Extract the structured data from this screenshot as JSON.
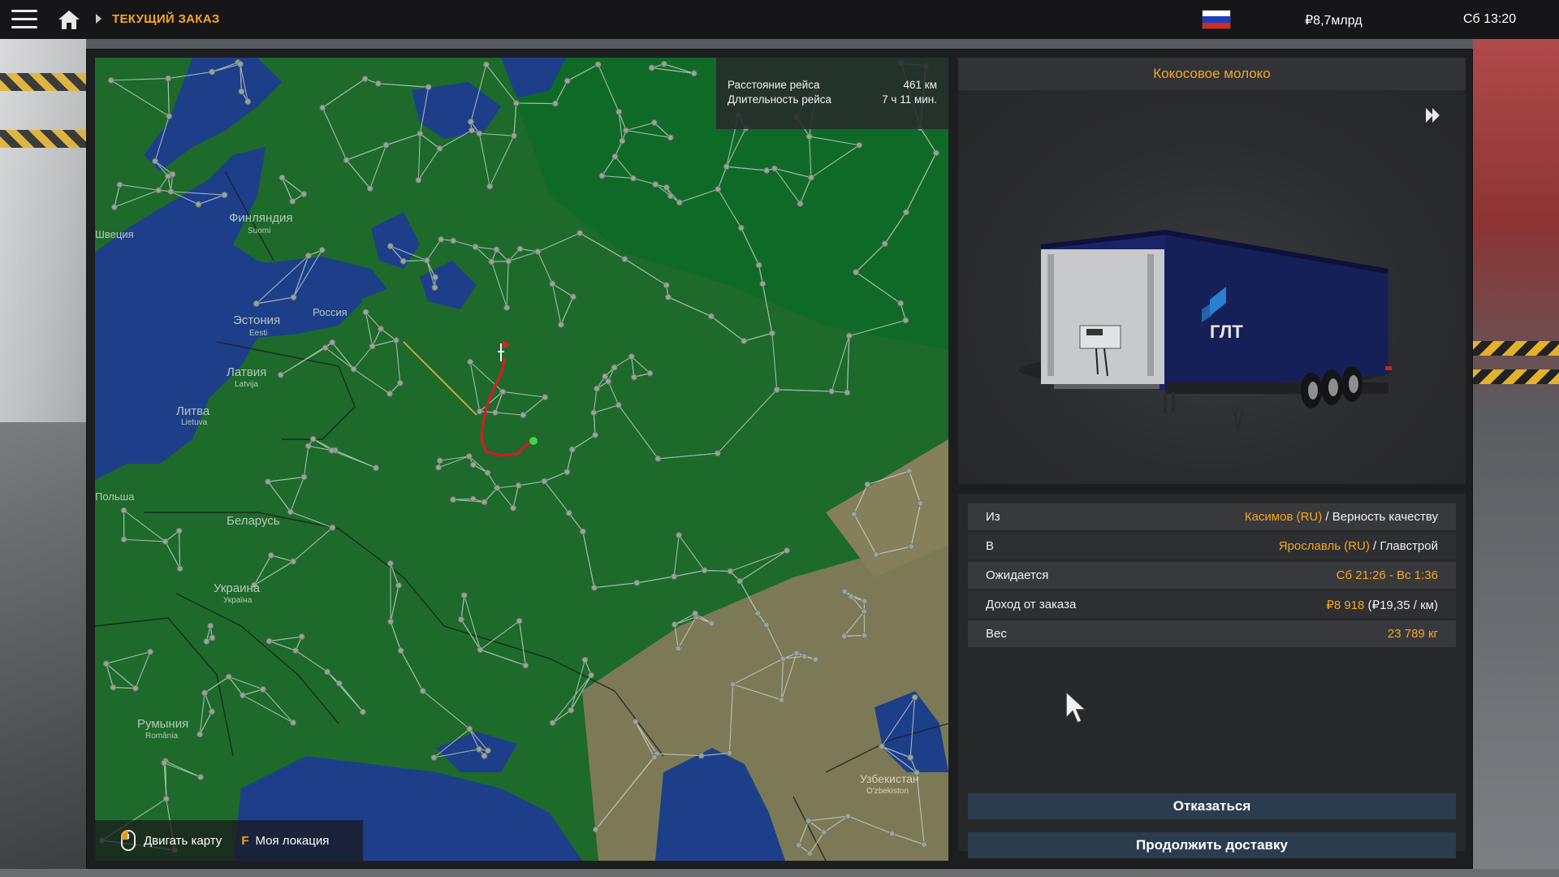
{
  "topbar": {
    "breadcrumb": "ТЕКУЩИЙ ЗАКАЗ",
    "money": "₽8,7млрд",
    "clock": "Сб 13:20",
    "flag_colors": [
      "#ffffff",
      "#1c3fbf",
      "#d52b1e"
    ]
  },
  "map": {
    "trip_distance_label": "Расстояние рейса",
    "trip_distance_value": "461 км",
    "trip_duration_label": "Длительность рейса",
    "trip_duration_value": "7 ч 11 мин.",
    "hint_move_label": "Двигать карту",
    "hint_key": "F",
    "hint_location_label": "Моя локация",
    "labels": [
      {
        "text": "Финляндия"
      },
      {
        "text": "Suomi"
      },
      {
        "text": "Эстония"
      },
      {
        "text": "Eesti"
      },
      {
        "text": "Латвия"
      },
      {
        "text": "Latvija"
      },
      {
        "text": "Литва"
      },
      {
        "text": "Lietuva"
      },
      {
        "text": "Беларусь"
      },
      {
        "text": "Украина"
      },
      {
        "text": "Україна"
      },
      {
        "text": "Румыния"
      },
      {
        "text": "România"
      },
      {
        "text": "Узбекистан"
      },
      {
        "text": "O'zbekiston"
      },
      {
        "text": "Россия"
      },
      {
        "text": "Швеция"
      },
      {
        "text": "Польша"
      }
    ]
  },
  "cargo": {
    "title": "Кокосовое молоко",
    "trailer_brand": "ГЛТ"
  },
  "details": {
    "from_label": "Из",
    "from_city": "Касимов (RU)",
    "from_sep": " / ",
    "from_company": "Верность качеству",
    "to_label": "В",
    "to_city": "Ярославль (RU)",
    "to_sep": " / ",
    "to_company": "Главстрой",
    "expected_label": "Ожидается",
    "expected_value": "Сб 21:26 - Вс 1:36",
    "income_label": "Доход от заказа",
    "income_value": "₽8 918",
    "income_rate": " (₽19,35 / км)",
    "weight_label": "Вес",
    "weight_value": "23 789 кг"
  },
  "buttons": {
    "cancel": "Отказаться",
    "continue": "Продолжить доставку"
  },
  "colors": {
    "accent": "#f5a623",
    "map_land": "#1d6a2b",
    "map_water": "#1d3f8a",
    "route": "#c8202a",
    "button": "#2b3c4f"
  }
}
